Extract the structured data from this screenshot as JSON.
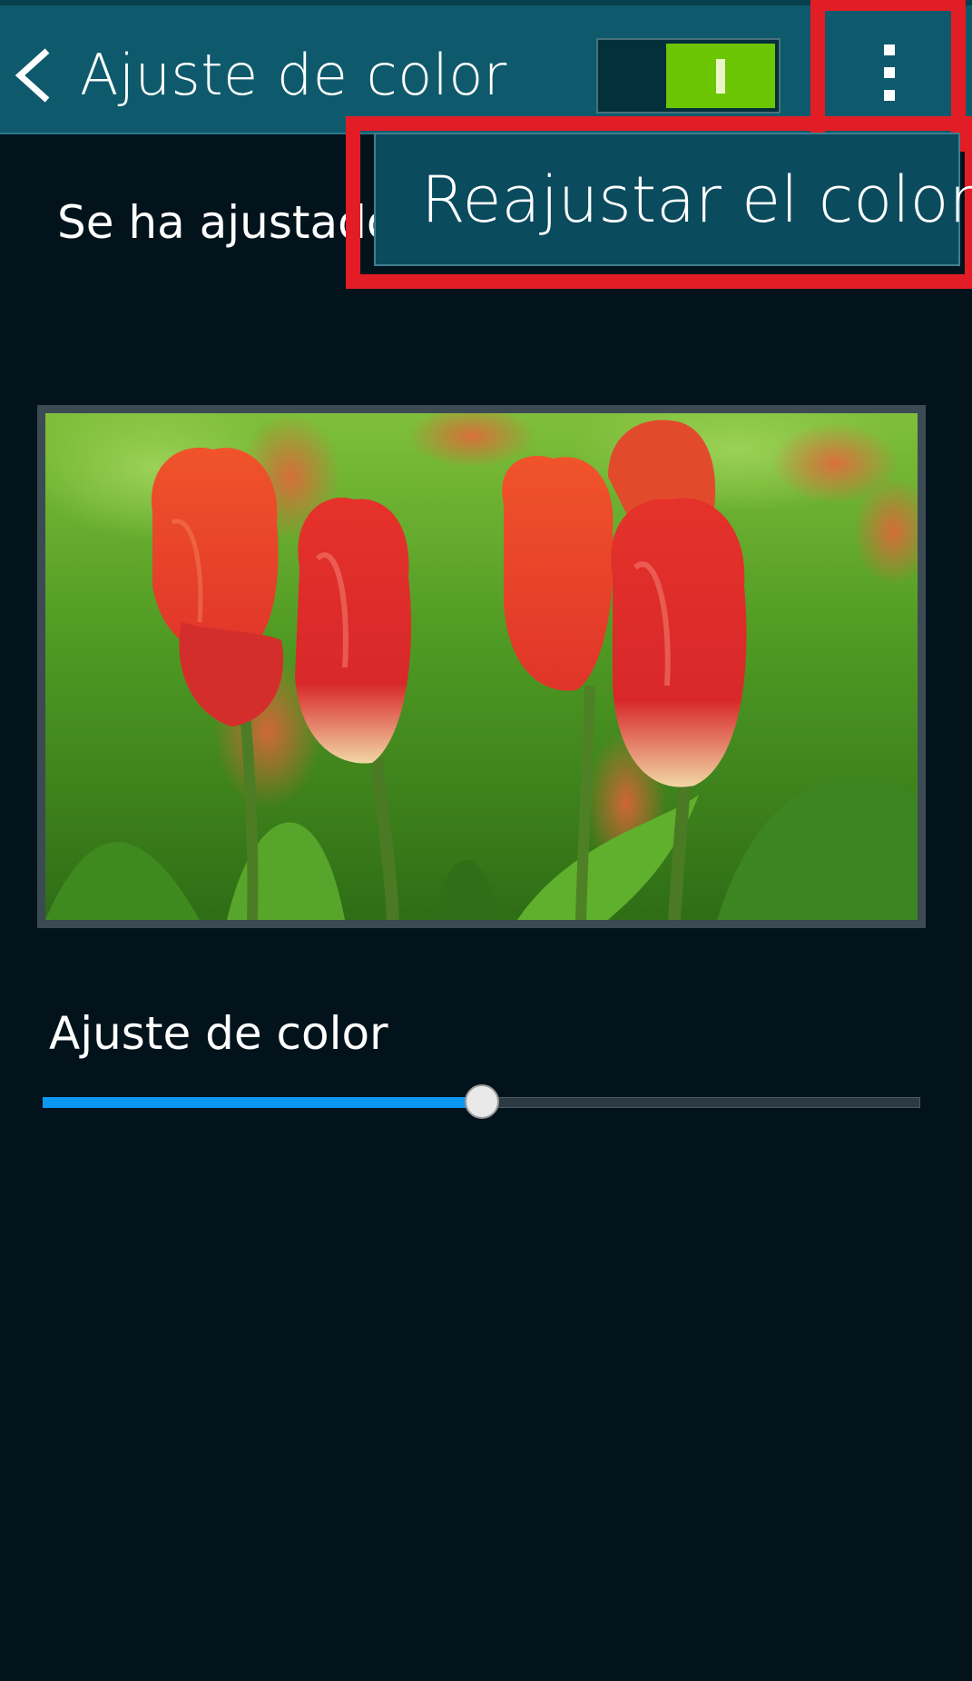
{
  "action_bar": {
    "title": "Ajuste de color",
    "back_icon": "chevron-left-icon",
    "switch_state": "on",
    "overflow_icon": "more-vertical-icon"
  },
  "status_text": "Se ha ajustado",
  "popup_menu": {
    "items": [
      {
        "label": "Reajustar el color"
      }
    ]
  },
  "preview": {
    "image": "red-tulips-photo"
  },
  "slider": {
    "label": "Ajuste de color",
    "value_fraction": 0.5
  },
  "colors": {
    "action_bar": "#0e5a6c",
    "background": "#02131c",
    "switch_on": "#6cc502",
    "slider_fill": "#0c98f0",
    "highlight": "#e21d25"
  }
}
